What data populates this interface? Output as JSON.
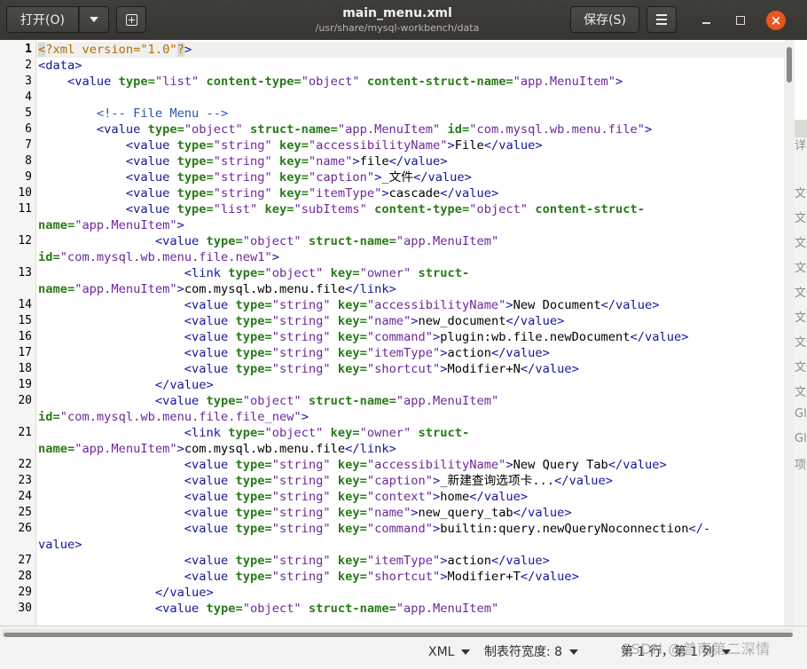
{
  "header": {
    "open_label": "打开(O)",
    "title": "main_menu.xml",
    "subtitle": "/usr/share/mysql-workbench/data",
    "save_label": "保存(S)",
    "close_glyph": "×"
  },
  "background_window": {
    "texts": [
      "详纟",
      "文件",
      "文件",
      "文件",
      "文件",
      "文件",
      "文件",
      "文件",
      "文件",
      "文件",
      "Gla",
      "Gla",
      "项"
    ]
  },
  "editor": {
    "current_line": 1,
    "lines": [
      {
        "n": "1",
        "t": [
          [
            "pim",
            "<"
          ],
          [
            "pi",
            "?xml version=\"1.0\""
          ],
          [
            "pim",
            "?"
          ],
          [
            "b",
            ">"
          ]
        ]
      },
      {
        "n": "2",
        "t": [
          [
            "b",
            "<data>"
          ]
        ]
      },
      {
        "n": "3",
        "t": [
          [
            "b",
            "    <value "
          ],
          [
            "g",
            "type="
          ],
          [
            "v",
            "\"list\" "
          ],
          [
            "g",
            "content-type="
          ],
          [
            "v",
            "\"object\" "
          ],
          [
            "g",
            "content-struct-name="
          ],
          [
            "v",
            "\"app.MenuItem\""
          ],
          [
            "b",
            ">"
          ]
        ]
      },
      {
        "n": "4",
        "t": []
      },
      {
        "n": "5",
        "t": [
          [
            "c",
            "        <!-- File Menu -->"
          ]
        ]
      },
      {
        "n": "6",
        "t": [
          [
            "b",
            "        <value "
          ],
          [
            "g",
            "type="
          ],
          [
            "v",
            "\"object\" "
          ],
          [
            "g",
            "struct-name="
          ],
          [
            "v",
            "\"app.MenuItem\" "
          ],
          [
            "g",
            "id="
          ],
          [
            "v",
            "\"com.mysql.wb.menu.file\""
          ],
          [
            "b",
            ">"
          ]
        ]
      },
      {
        "n": "7",
        "t": [
          [
            "b",
            "            <value "
          ],
          [
            "g",
            "type="
          ],
          [
            "v",
            "\"string\" "
          ],
          [
            "g",
            "key="
          ],
          [
            "v",
            "\"accessibilityName\""
          ],
          [
            "b",
            ">"
          ],
          [
            "x",
            "File"
          ],
          [
            "b",
            "</value>"
          ]
        ]
      },
      {
        "n": "8",
        "t": [
          [
            "b",
            "            <value "
          ],
          [
            "g",
            "type="
          ],
          [
            "v",
            "\"string\" "
          ],
          [
            "g",
            "key="
          ],
          [
            "v",
            "\"name\""
          ],
          [
            "b",
            ">"
          ],
          [
            "x",
            "file"
          ],
          [
            "b",
            "</value>"
          ]
        ]
      },
      {
        "n": "9",
        "t": [
          [
            "b",
            "            <value "
          ],
          [
            "g",
            "type="
          ],
          [
            "v",
            "\"string\" "
          ],
          [
            "g",
            "key="
          ],
          [
            "v",
            "\"caption\""
          ],
          [
            "b",
            ">"
          ],
          [
            "x",
            "_文件"
          ],
          [
            "b",
            "</value>"
          ]
        ]
      },
      {
        "n": "10",
        "t": [
          [
            "b",
            "            <value "
          ],
          [
            "g",
            "type="
          ],
          [
            "v",
            "\"string\" "
          ],
          [
            "g",
            "key="
          ],
          [
            "v",
            "\"itemType\""
          ],
          [
            "b",
            ">"
          ],
          [
            "x",
            "cascade"
          ],
          [
            "b",
            "</value>"
          ]
        ]
      },
      {
        "n": "11",
        "t": [
          [
            "b",
            "            <value "
          ],
          [
            "g",
            "type="
          ],
          [
            "v",
            "\"list\" "
          ],
          [
            "g",
            "key="
          ],
          [
            "v",
            "\"subItems\" "
          ],
          [
            "g",
            "content-type="
          ],
          [
            "v",
            "\"object\" "
          ],
          [
            "g",
            "content-struct-"
          ]
        ]
      },
      {
        "n": "",
        "t": [
          [
            "g",
            "name="
          ],
          [
            "v",
            "\"app.MenuItem\""
          ],
          [
            "b",
            ">"
          ]
        ]
      },
      {
        "n": "12",
        "t": [
          [
            "b",
            "                <value "
          ],
          [
            "g",
            "type="
          ],
          [
            "v",
            "\"object\" "
          ],
          [
            "g",
            "struct-name="
          ],
          [
            "v",
            "\"app.MenuItem\""
          ]
        ]
      },
      {
        "n": "",
        "t": [
          [
            "g",
            "id="
          ],
          [
            "v",
            "\"com.mysql.wb.menu.file.new1\""
          ],
          [
            "b",
            ">"
          ]
        ]
      },
      {
        "n": "13",
        "t": [
          [
            "b",
            "                    <link "
          ],
          [
            "g",
            "type="
          ],
          [
            "v",
            "\"object\" "
          ],
          [
            "g",
            "key="
          ],
          [
            "v",
            "\"owner\" "
          ],
          [
            "g",
            "struct-"
          ]
        ]
      },
      {
        "n": "",
        "t": [
          [
            "g",
            "name="
          ],
          [
            "v",
            "\"app.MenuItem\""
          ],
          [
            "b",
            ">"
          ],
          [
            "x",
            "com.mysql.wb.menu.file"
          ],
          [
            "b",
            "</link>"
          ]
        ]
      },
      {
        "n": "14",
        "t": [
          [
            "b",
            "                    <value "
          ],
          [
            "g",
            "type="
          ],
          [
            "v",
            "\"string\" "
          ],
          [
            "g",
            "key="
          ],
          [
            "v",
            "\"accessibilityName\""
          ],
          [
            "b",
            ">"
          ],
          [
            "x",
            "New Document"
          ],
          [
            "b",
            "</value>"
          ]
        ]
      },
      {
        "n": "15",
        "t": [
          [
            "b",
            "                    <value "
          ],
          [
            "g",
            "type="
          ],
          [
            "v",
            "\"string\" "
          ],
          [
            "g",
            "key="
          ],
          [
            "v",
            "\"name\""
          ],
          [
            "b",
            ">"
          ],
          [
            "x",
            "new_document"
          ],
          [
            "b",
            "</value>"
          ]
        ]
      },
      {
        "n": "16",
        "t": [
          [
            "b",
            "                    <value "
          ],
          [
            "g",
            "type="
          ],
          [
            "v",
            "\"string\" "
          ],
          [
            "g",
            "key="
          ],
          [
            "v",
            "\"command\""
          ],
          [
            "b",
            ">"
          ],
          [
            "x",
            "plugin:wb.file.newDocument"
          ],
          [
            "b",
            "</value>"
          ]
        ]
      },
      {
        "n": "17",
        "t": [
          [
            "b",
            "                    <value "
          ],
          [
            "g",
            "type="
          ],
          [
            "v",
            "\"string\" "
          ],
          [
            "g",
            "key="
          ],
          [
            "v",
            "\"itemType\""
          ],
          [
            "b",
            ">"
          ],
          [
            "x",
            "action"
          ],
          [
            "b",
            "</value>"
          ]
        ]
      },
      {
        "n": "18",
        "t": [
          [
            "b",
            "                    <value "
          ],
          [
            "g",
            "type="
          ],
          [
            "v",
            "\"string\" "
          ],
          [
            "g",
            "key="
          ],
          [
            "v",
            "\"shortcut\""
          ],
          [
            "b",
            ">"
          ],
          [
            "x",
            "Modifier+N"
          ],
          [
            "b",
            "</value>"
          ]
        ]
      },
      {
        "n": "19",
        "t": [
          [
            "b",
            "                </value>"
          ]
        ]
      },
      {
        "n": "20",
        "t": [
          [
            "b",
            "                <value "
          ],
          [
            "g",
            "type="
          ],
          [
            "v",
            "\"object\" "
          ],
          [
            "g",
            "struct-name="
          ],
          [
            "v",
            "\"app.MenuItem\""
          ]
        ]
      },
      {
        "n": "",
        "t": [
          [
            "g",
            "id="
          ],
          [
            "v",
            "\"com.mysql.wb.menu.file.file_new\""
          ],
          [
            "b",
            ">"
          ]
        ]
      },
      {
        "n": "21",
        "t": [
          [
            "b",
            "                    <link "
          ],
          [
            "g",
            "type="
          ],
          [
            "v",
            "\"object\" "
          ],
          [
            "g",
            "key="
          ],
          [
            "v",
            "\"owner\" "
          ],
          [
            "g",
            "struct-"
          ]
        ]
      },
      {
        "n": "",
        "t": [
          [
            "g",
            "name="
          ],
          [
            "v",
            "\"app.MenuItem\""
          ],
          [
            "b",
            ">"
          ],
          [
            "x",
            "com.mysql.wb.menu.file"
          ],
          [
            "b",
            "</link>"
          ]
        ]
      },
      {
        "n": "22",
        "t": [
          [
            "b",
            "                    <value "
          ],
          [
            "g",
            "type="
          ],
          [
            "v",
            "\"string\" "
          ],
          [
            "g",
            "key="
          ],
          [
            "v",
            "\"accessibilityName\""
          ],
          [
            "b",
            ">"
          ],
          [
            "x",
            "New Query Tab"
          ],
          [
            "b",
            "</value>"
          ]
        ]
      },
      {
        "n": "23",
        "t": [
          [
            "b",
            "                    <value "
          ],
          [
            "g",
            "type="
          ],
          [
            "v",
            "\"string\" "
          ],
          [
            "g",
            "key="
          ],
          [
            "v",
            "\"caption\""
          ],
          [
            "b",
            ">"
          ],
          [
            "x",
            "_新建查询选项卡..."
          ],
          [
            "b",
            "</value>"
          ]
        ]
      },
      {
        "n": "24",
        "t": [
          [
            "b",
            "                    <value "
          ],
          [
            "g",
            "type="
          ],
          [
            "v",
            "\"string\" "
          ],
          [
            "g",
            "key="
          ],
          [
            "v",
            "\"context\""
          ],
          [
            "b",
            ">"
          ],
          [
            "x",
            "home"
          ],
          [
            "b",
            "</value>"
          ]
        ]
      },
      {
        "n": "25",
        "t": [
          [
            "b",
            "                    <value "
          ],
          [
            "g",
            "type="
          ],
          [
            "v",
            "\"string\" "
          ],
          [
            "g",
            "key="
          ],
          [
            "v",
            "\"name\""
          ],
          [
            "b",
            ">"
          ],
          [
            "x",
            "new_query_tab"
          ],
          [
            "b",
            "</value>"
          ]
        ]
      },
      {
        "n": "26",
        "t": [
          [
            "b",
            "                    <value "
          ],
          [
            "g",
            "type="
          ],
          [
            "v",
            "\"string\" "
          ],
          [
            "g",
            "key="
          ],
          [
            "v",
            "\"command\""
          ],
          [
            "b",
            ">"
          ],
          [
            "x",
            "builtin:query.newQueryNoconnection"
          ],
          [
            "b",
            "</-"
          ]
        ]
      },
      {
        "n": "",
        "t": [
          [
            "b",
            "value>"
          ]
        ]
      },
      {
        "n": "27",
        "t": [
          [
            "b",
            "                    <value "
          ],
          [
            "g",
            "type="
          ],
          [
            "v",
            "\"string\" "
          ],
          [
            "g",
            "key="
          ],
          [
            "v",
            "\"itemType\""
          ],
          [
            "b",
            ">"
          ],
          [
            "x",
            "action"
          ],
          [
            "b",
            "</value>"
          ]
        ]
      },
      {
        "n": "28",
        "t": [
          [
            "b",
            "                    <value "
          ],
          [
            "g",
            "type="
          ],
          [
            "v",
            "\"string\" "
          ],
          [
            "g",
            "key="
          ],
          [
            "v",
            "\"shortcut\""
          ],
          [
            "b",
            ">"
          ],
          [
            "x",
            "Modifier+T"
          ],
          [
            "b",
            "</value>"
          ]
        ]
      },
      {
        "n": "29",
        "t": [
          [
            "b",
            "                </value>"
          ]
        ]
      },
      {
        "n": "30",
        "t": [
          [
            "b",
            "                <value "
          ],
          [
            "g",
            "type="
          ],
          [
            "v",
            "\"object\" "
          ],
          [
            "g",
            "struct-name="
          ],
          [
            "v",
            "\"app.MenuItem\""
          ]
        ]
      }
    ]
  },
  "statusbar": {
    "language": "XML",
    "tab_width": "制表符宽度: 8",
    "position": "第 1 行，第 1 列"
  },
  "watermark": "CSDN @普南第二深情",
  "colors": {
    "tag": "#15159b",
    "attribute": "#2a7b1a",
    "value": "#6c2899",
    "comment": "#2a55a9",
    "close_button": "#e95420"
  }
}
